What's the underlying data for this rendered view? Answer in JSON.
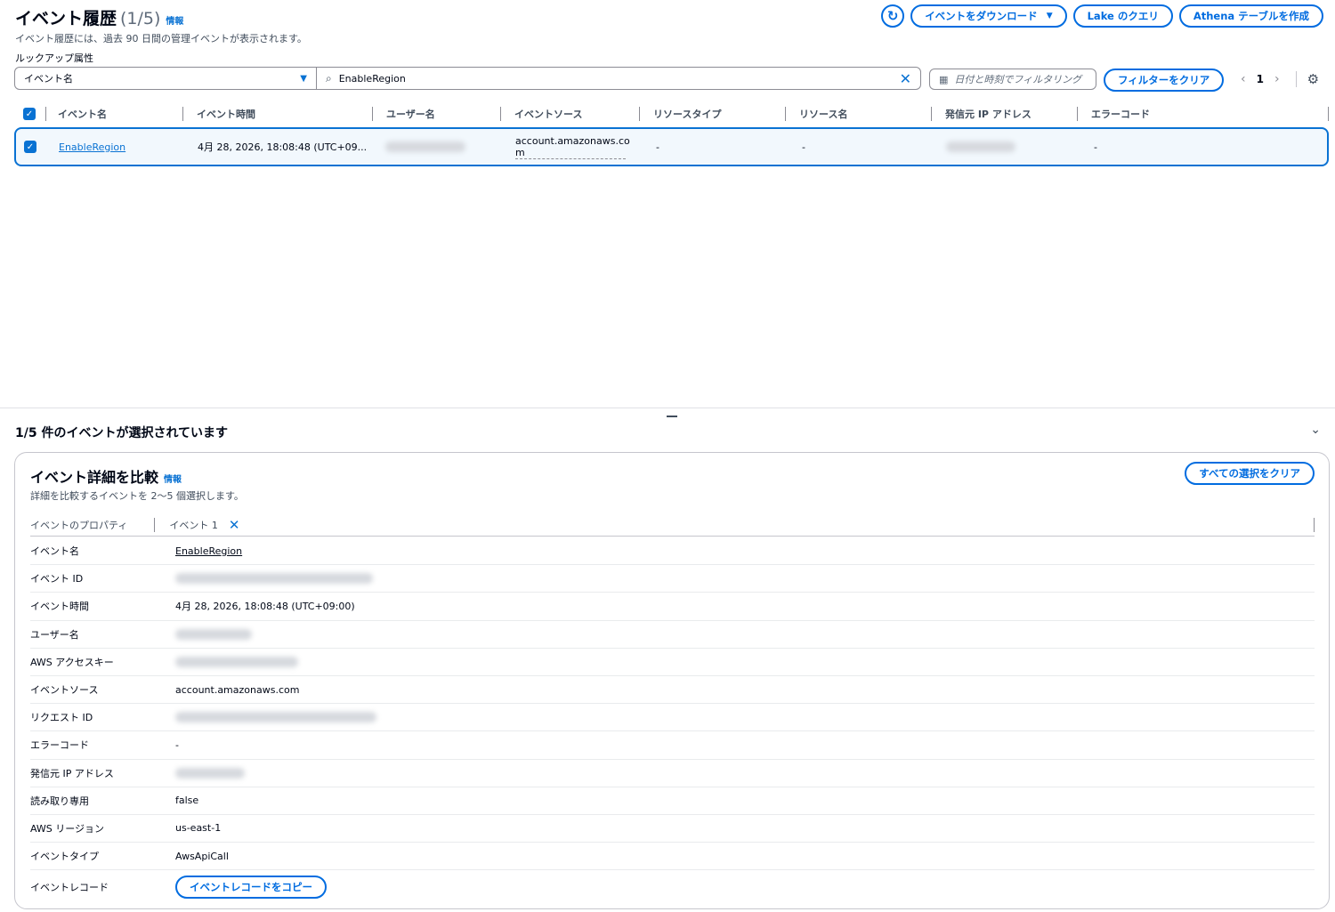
{
  "header": {
    "title": "イベント履歴",
    "count": "(1/5)",
    "info": "情報",
    "description": "イベント履歴には、過去 90 日間の管理イベントが表示されます。",
    "actions": {
      "download": "イベントをダウンロード",
      "lake_query": "Lake のクエリ",
      "athena": "Athena テーブルを作成"
    }
  },
  "filter": {
    "lookup_label": "ルックアップ属性",
    "lookup_value": "イベント名",
    "search_value": "EnableRegion",
    "date_placeholder": "日付と時刻でフィルタリング",
    "clear_filter": "フィルターをクリア",
    "page": "1"
  },
  "table": {
    "columns": [
      "イベント名",
      "イベント時間",
      "ユーザー名",
      "イベントソース",
      "リソースタイプ",
      "リソース名",
      "発信元 IP アドレス",
      "エラーコード"
    ],
    "row": {
      "event_name": "EnableRegion",
      "event_time": "4月 28, 2026, 18:08:48 (UTC+09...",
      "event_source_line1": "account.amazonaws.co",
      "event_source_line2": "m",
      "resource_type": "-",
      "resource_name": "-",
      "error_code": "-"
    }
  },
  "split": {
    "title": "1/5 件のイベントが選択されています",
    "compare_title": "イベント詳細を比較",
    "info": "情報",
    "compare_desc": "詳細を比較するイベントを 2〜5 個選択します。",
    "clear_all": "すべての選択をクリア",
    "prop_header": "イベントのプロパティ",
    "event_header": "イベント 1",
    "rows": [
      {
        "key": "イベント名",
        "value": "EnableRegion"
      },
      {
        "key": "イベント ID",
        "value": ""
      },
      {
        "key": "イベント時間",
        "value": "4月 28, 2026, 18:08:48 (UTC+09:00)"
      },
      {
        "key": "ユーザー名",
        "value": ""
      },
      {
        "key": "AWS アクセスキー",
        "value": ""
      },
      {
        "key": "イベントソース",
        "value": "account.amazonaws.com"
      },
      {
        "key": "リクエスト ID",
        "value": ""
      },
      {
        "key": "エラーコード",
        "value": "-"
      },
      {
        "key": "発信元 IP アドレス",
        "value": ""
      },
      {
        "key": "読み取り専用",
        "value": "false"
      },
      {
        "key": "AWS リージョン",
        "value": "us-east-1"
      },
      {
        "key": "イベントタイプ",
        "value": "AwsApiCall"
      },
      {
        "key": "イベントレコード",
        "value": "イベントレコードをコピー"
      }
    ]
  },
  "colors": {
    "accent": "#0972d3",
    "button_border": "#006ce0",
    "selected_row_bg": "#f2f8fd"
  }
}
